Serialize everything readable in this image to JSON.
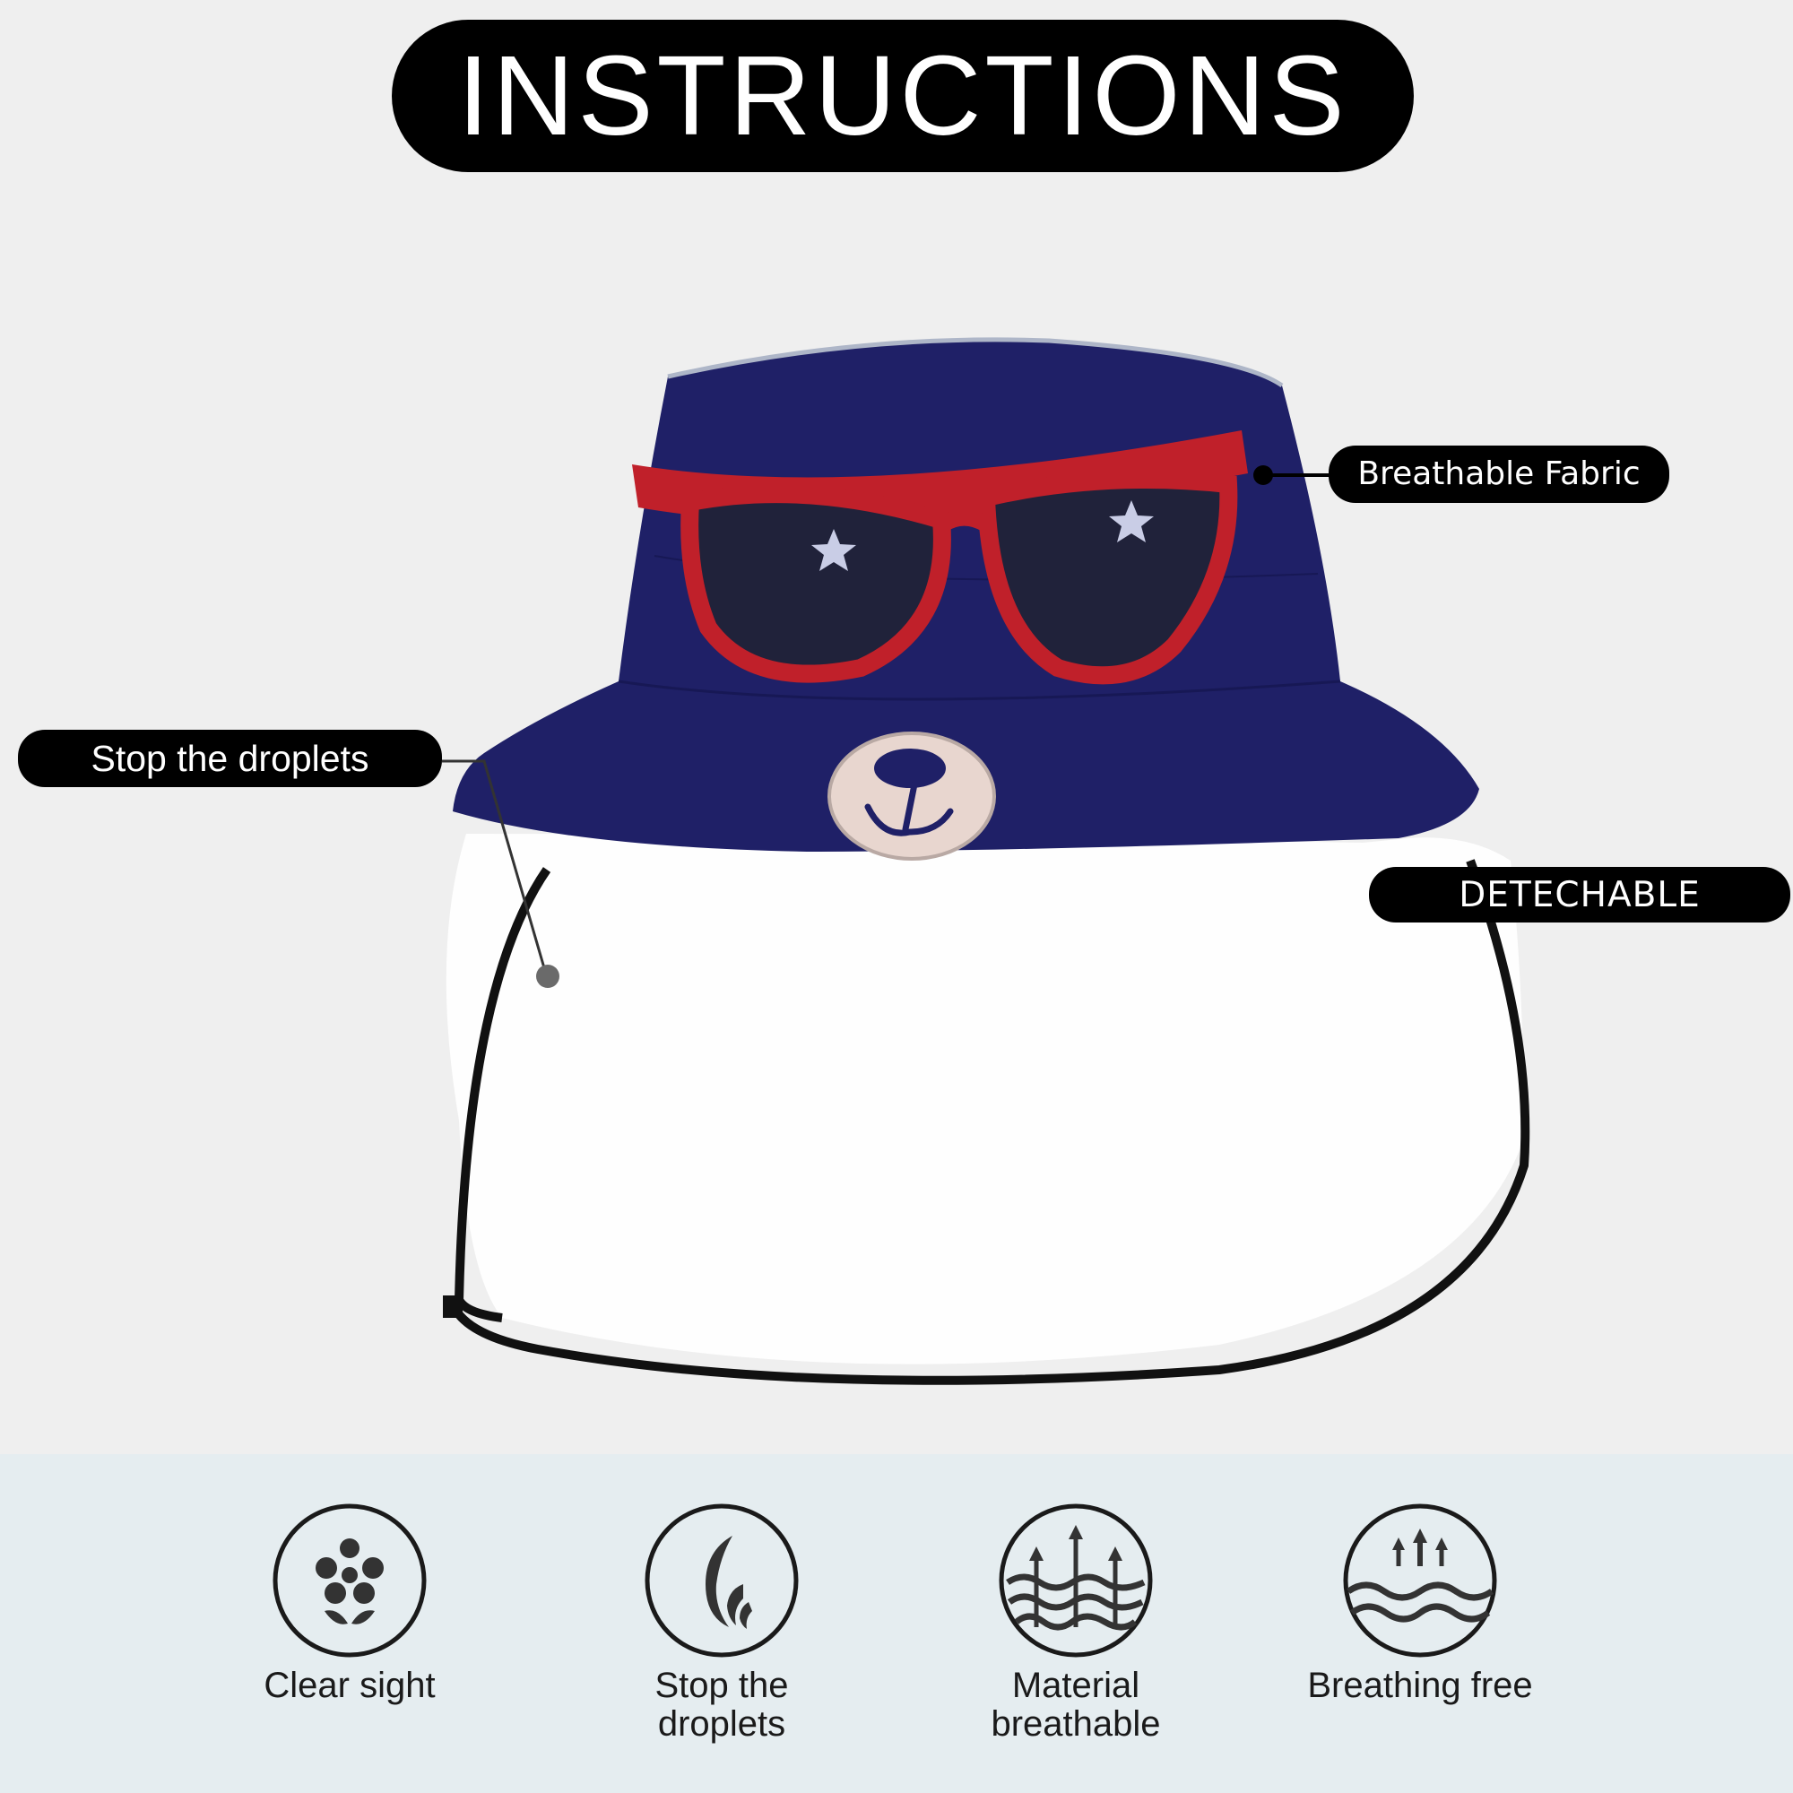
{
  "header": {
    "title": "INSTRUCTIONS"
  },
  "callouts": {
    "breathable_fabric": "Breathable Fabric",
    "stop_droplets": "Stop the droplets",
    "detachable": "DETECHABLE"
  },
  "colors": {
    "hat": "#1f2067",
    "glasses_frame": "#c0202a",
    "pill": "#000000",
    "band": "#e5edf0"
  },
  "features": [
    {
      "icon": "clear-sight-icon",
      "label": "Clear sight"
    },
    {
      "icon": "droplet-shield-icon",
      "label": "Stop the\ndroplets"
    },
    {
      "icon": "breathable-material-icon",
      "label": "Material\nbreathable"
    },
    {
      "icon": "breathing-free-icon",
      "label": "Breathing free"
    }
  ]
}
